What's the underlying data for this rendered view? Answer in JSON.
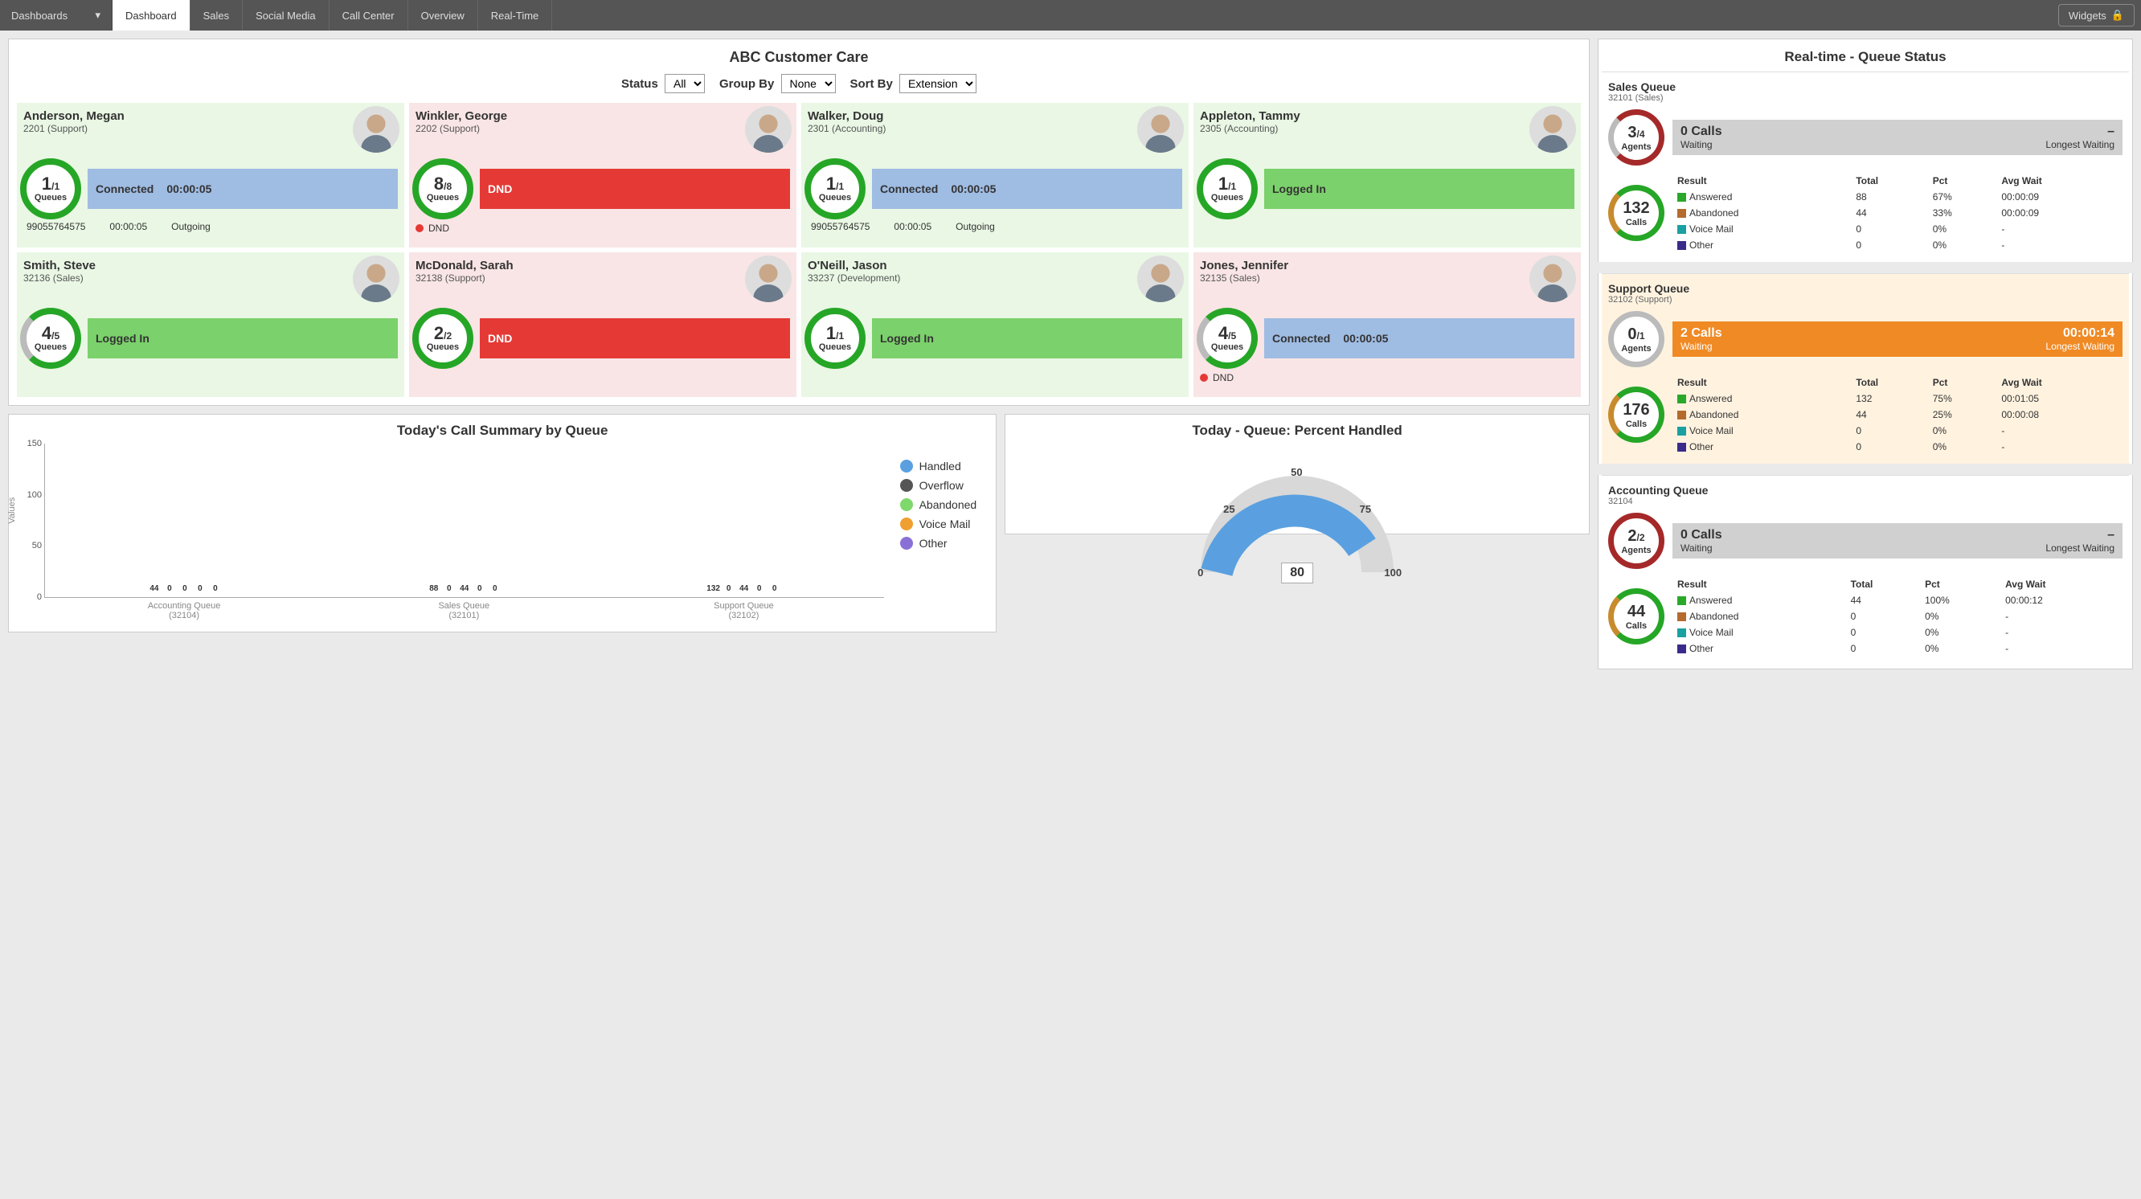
{
  "topbar": {
    "brand": "Dashboards",
    "tabs": [
      "Dashboard",
      "Sales",
      "Social Media",
      "Call Center",
      "Overview",
      "Real-Time"
    ],
    "widgets_label": "Widgets"
  },
  "agents_panel": {
    "title": "ABC Customer Care",
    "filters": {
      "status_label": "Status",
      "status_value": "All",
      "group_label": "Group By",
      "group_value": "None",
      "sort_label": "Sort By",
      "sort_value": "Extension"
    }
  },
  "agents": [
    {
      "name": "Anderson, Megan",
      "sub": "2201 (Support)",
      "q_cur": "1",
      "q_tot": "/1",
      "q_label": "Queues",
      "status": "Connected",
      "timer": "00:00:05",
      "bg": "green",
      "bar": "connected",
      "ring": "full",
      "foot_a": "99055764575",
      "foot_b": "00:00:05",
      "foot_c": "Outgoing"
    },
    {
      "name": "Winkler, George",
      "sub": "2202 (Support)",
      "q_cur": "8",
      "q_tot": "/8",
      "q_label": "Queues",
      "status": "DND",
      "timer": "",
      "bg": "red",
      "bar": "dnd",
      "ring": "full",
      "dnd": "DND"
    },
    {
      "name": "Walker, Doug",
      "sub": "2301 (Accounting)",
      "q_cur": "1",
      "q_tot": "/1",
      "q_label": "Queues",
      "status": "Connected",
      "timer": "00:00:05",
      "bg": "green",
      "bar": "connected",
      "ring": "full",
      "foot_a": "99055764575",
      "foot_b": "00:00:05",
      "foot_c": "Outgoing"
    },
    {
      "name": "Appleton, Tammy",
      "sub": "2305 (Accounting)",
      "q_cur": "1",
      "q_tot": "/1",
      "q_label": "Queues",
      "status": "Logged In",
      "timer": "",
      "bg": "green",
      "bar": "logged",
      "ring": "full"
    },
    {
      "name": "Smith, Steve",
      "sub": "32136 (Sales)",
      "q_cur": "4",
      "q_tot": "/5",
      "q_label": "Queues",
      "status": "Logged In",
      "timer": "",
      "bg": "green",
      "bar": "logged",
      "ring": "partial"
    },
    {
      "name": "McDonald, Sarah",
      "sub": "32138 (Support)",
      "q_cur": "2",
      "q_tot": "/2",
      "q_label": "Queues",
      "status": "DND",
      "timer": "",
      "bg": "red",
      "bar": "dnd",
      "ring": "full"
    },
    {
      "name": "O'Neill, Jason",
      "sub": "33237 (Development)",
      "q_cur": "1",
      "q_tot": "/1",
      "q_label": "Queues",
      "status": "Logged In",
      "timer": "",
      "bg": "green",
      "bar": "logged",
      "ring": "full"
    },
    {
      "name": "Jones, Jennifer",
      "sub": "32135 (Sales)",
      "q_cur": "4",
      "q_tot": "/5",
      "q_label": "Queues",
      "status": "Connected",
      "timer": "00:00:05",
      "bg": "red",
      "bar": "connected",
      "ring": "partial",
      "dnd": "DND"
    }
  ],
  "bar_chart": {
    "title": "Today's Call Summary by Queue",
    "ylabel": "Values",
    "legend": [
      "Handled",
      "Overflow",
      "Abandoned",
      "Voice Mail",
      "Other"
    ],
    "colors": [
      "#5aa0e0",
      "#555555",
      "#7ed86b",
      "#f0a030",
      "#8a70d6"
    ]
  },
  "gauge_chart": {
    "title": "Today - Queue: Percent Handled",
    "ticks": {
      "t0": "0",
      "t25": "25",
      "t50": "50",
      "t75": "75",
      "t100": "100"
    },
    "value": "80"
  },
  "rt_panel": {
    "title": "Real-time - Queue Status"
  },
  "queues": [
    {
      "name": "Sales Queue",
      "sub": "32101 (Sales)",
      "agents_cur": "3",
      "agents_tot": "/4",
      "agents_label": "Agents",
      "calls_n": "0 Calls",
      "lw": "–",
      "waiting": "Waiting",
      "lw_label": "Longest Waiting",
      "call_ring": "132",
      "calls_label": "Calls",
      "info_bg": "gray",
      "agent_ring": "ring-agents",
      "rows": [
        {
          "label": "Answered",
          "total": "88",
          "pct": "67%",
          "avg": "00:00:09",
          "c": "#2aa82a"
        },
        {
          "label": "Abandoned",
          "total": "44",
          "pct": "33%",
          "avg": "00:00:09",
          "c": "#b56a2e"
        },
        {
          "label": "Voice Mail",
          "total": "0",
          "pct": "0%",
          "avg": "-",
          "c": "#1aa0a0"
        },
        {
          "label": "Other",
          "total": "0",
          "pct": "0%",
          "avg": "-",
          "c": "#3a2a8a"
        }
      ],
      "headers": {
        "result": "Result",
        "total": "Total",
        "pct": "Pct",
        "avg": "Avg Wait"
      }
    },
    {
      "name": "Support Queue",
      "sub": "32102 (Support)",
      "orange": true,
      "agents_cur": "0",
      "agents_tot": "/1",
      "agents_label": "Agents",
      "calls_n": "2 Calls",
      "lw": "00:00:14",
      "waiting": "Waiting",
      "lw_label": "Longest Waiting",
      "call_ring": "176",
      "calls_label": "Calls",
      "info_bg": "orange",
      "agent_ring": "ring-agents-none",
      "rows": [
        {
          "label": "Answered",
          "total": "132",
          "pct": "75%",
          "avg": "00:01:05",
          "c": "#2aa82a"
        },
        {
          "label": "Abandoned",
          "total": "44",
          "pct": "25%",
          "avg": "00:00:08",
          "c": "#b56a2e"
        },
        {
          "label": "Voice Mail",
          "total": "0",
          "pct": "0%",
          "avg": "-",
          "c": "#1aa0a0"
        },
        {
          "label": "Other",
          "total": "0",
          "pct": "0%",
          "avg": "-",
          "c": "#3a2a8a"
        }
      ],
      "headers": {
        "result": "Result",
        "total": "Total",
        "pct": "Pct",
        "avg": "Avg Wait"
      }
    },
    {
      "name": "Accounting Queue",
      "sub": "32104",
      "agents_cur": "2",
      "agents_tot": "/2",
      "agents_label": "Agents",
      "calls_n": "0 Calls",
      "lw": "–",
      "waiting": "Waiting",
      "lw_label": "Longest Waiting",
      "call_ring": "44",
      "calls_label": "Calls",
      "info_bg": "gray",
      "agent_ring": "ring-agents-full",
      "rows": [
        {
          "label": "Answered",
          "total": "44",
          "pct": "100%",
          "avg": "00:00:12",
          "c": "#2aa82a"
        },
        {
          "label": "Abandoned",
          "total": "0",
          "pct": "0%",
          "avg": "-",
          "c": "#b56a2e"
        },
        {
          "label": "Voice Mail",
          "total": "0",
          "pct": "0%",
          "avg": "-",
          "c": "#1aa0a0"
        },
        {
          "label": "Other",
          "total": "0",
          "pct": "0%",
          "avg": "-",
          "c": "#3a2a8a"
        }
      ],
      "headers": {
        "result": "Result",
        "total": "Total",
        "pct": "Pct",
        "avg": "Avg Wait"
      }
    }
  ],
  "chart_data": {
    "bar": {
      "type": "bar",
      "title": "Today's Call Summary by Queue",
      "ylabel": "Values",
      "ylim": [
        0,
        150
      ],
      "yticks": [
        0,
        50,
        100,
        150
      ],
      "categories": [
        "Accounting Queue (32104)",
        "Sales Queue (32101)",
        "Support Queue (32102)"
      ],
      "series": [
        {
          "name": "Handled",
          "color": "#5aa0e0",
          "values": [
            44,
            88,
            132
          ]
        },
        {
          "name": "Overflow",
          "color": "#555555",
          "values": [
            0,
            0,
            0
          ]
        },
        {
          "name": "Abandoned",
          "color": "#7ed86b",
          "values": [
            0,
            44,
            44
          ]
        },
        {
          "name": "Voice Mail",
          "color": "#f0a030",
          "values": [
            0,
            0,
            0
          ]
        },
        {
          "name": "Other",
          "color": "#8a70d6",
          "values": [
            0,
            0,
            0
          ]
        }
      ]
    },
    "gauge": {
      "type": "gauge",
      "title": "Today - Queue: Percent Handled",
      "min": 0,
      "max": 100,
      "value": 80,
      "ticks": [
        0,
        25,
        50,
        75,
        100
      ]
    }
  }
}
